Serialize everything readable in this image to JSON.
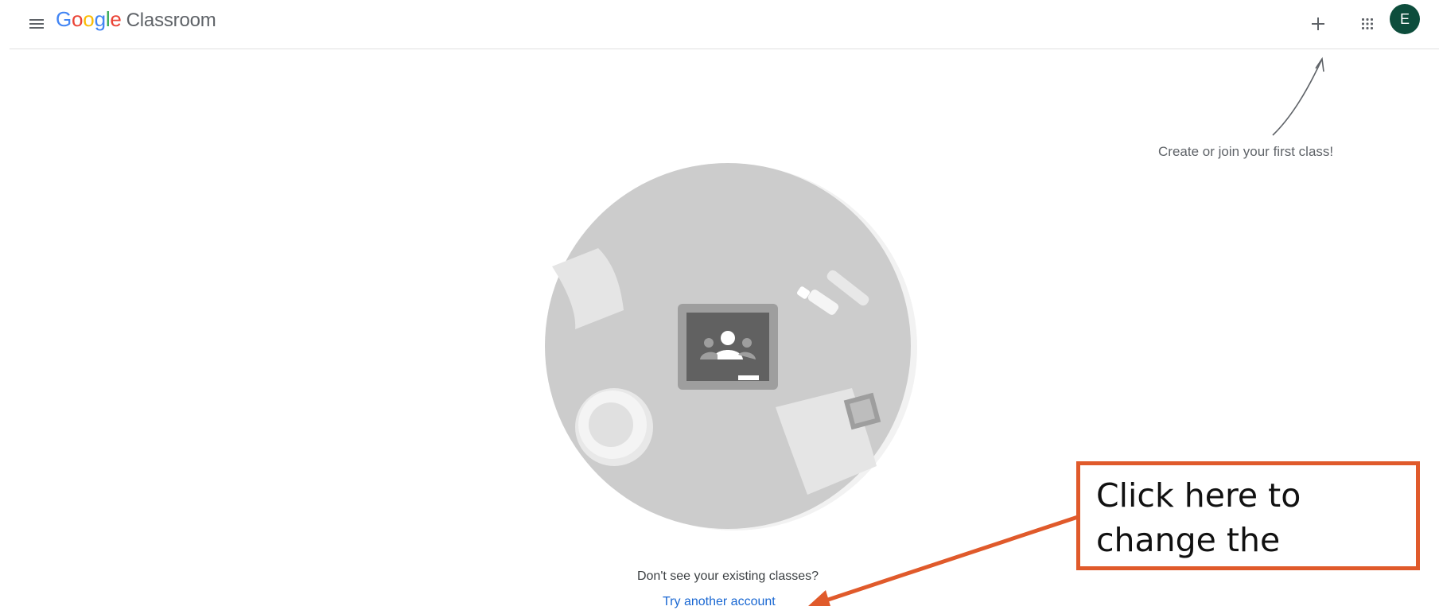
{
  "header": {
    "logo_letters": [
      {
        "char": "G",
        "color": "#4285f4"
      },
      {
        "char": "o",
        "color": "#ea4335"
      },
      {
        "char": "o",
        "color": "#fbbc05"
      },
      {
        "char": "g",
        "color": "#4285f4"
      },
      {
        "char": "l",
        "color": "#34a853"
      },
      {
        "char": "e",
        "color": "#ea4335"
      }
    ],
    "product_name": "Classroom",
    "icons": [
      "menu-icon",
      "add-icon",
      "apps-icon"
    ],
    "avatar_letter": "E",
    "avatar_color": "#0d4d3c"
  },
  "empty_state": {
    "hint": "Create or join your first class!",
    "question": "Don't see your existing classes?",
    "link_label": "Try another account"
  },
  "annotation": {
    "callout_line1": "Click here to",
    "callout_line2": "change the account",
    "color": "#e05a2b"
  }
}
